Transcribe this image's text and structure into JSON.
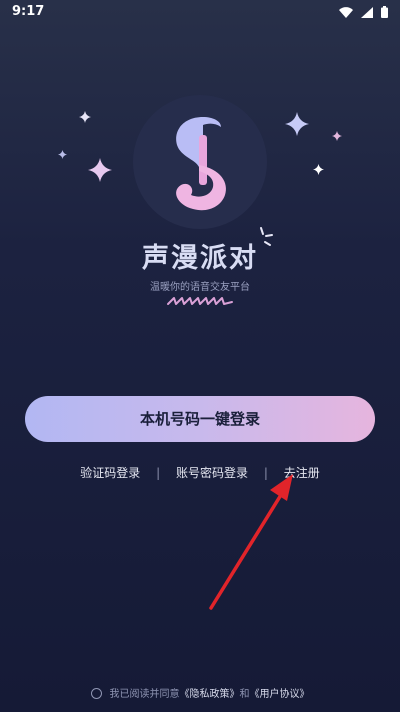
{
  "status_bar": {
    "time": "9:17",
    "icons": [
      "wifi-icon",
      "signal-icon",
      "battery-icon"
    ]
  },
  "app": {
    "title": "声漫派对",
    "subtitle": "温暖你的语音交友平台",
    "logo_letter": "S"
  },
  "login": {
    "primary_button": "本机号码一键登录",
    "links": [
      "验证码登录",
      "账号密码登录",
      "去注册"
    ],
    "separator": "|"
  },
  "agreement": {
    "prefix": "我已阅读并同意",
    "privacy": "《隐私政策》",
    "and": "和",
    "user_agreement": "《用户协议》"
  },
  "colors": {
    "background": "#1c2240",
    "button_start": "#b2b7f3",
    "button_end": "#e6b5de",
    "arrow": "#e1242a"
  }
}
